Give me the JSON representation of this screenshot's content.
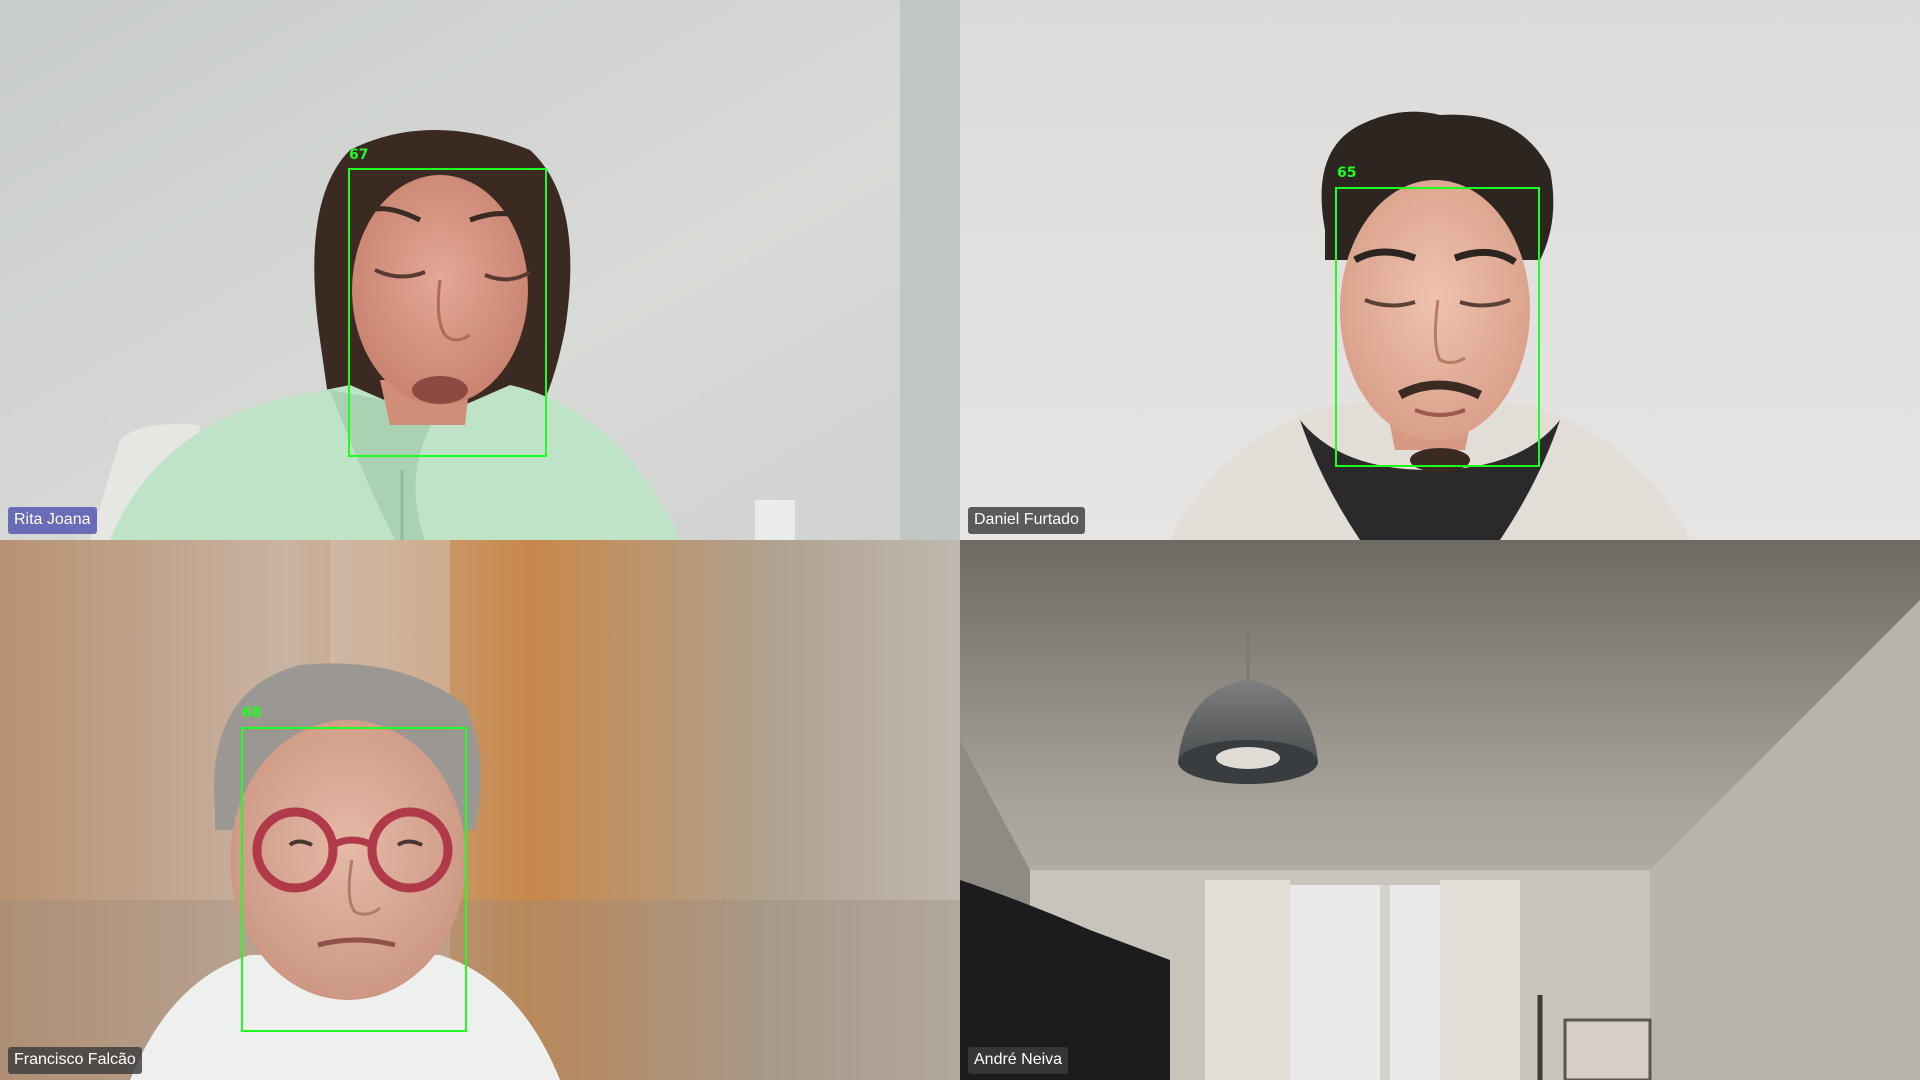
{
  "participants": [
    {
      "name": "Rita Joana",
      "active_speaker": true,
      "face_score": "67"
    },
    {
      "name": "Daniel Furtado",
      "active_speaker": false,
      "face_score": "65"
    },
    {
      "name": "Francisco Falcão",
      "active_speaker": false,
      "face_score": "68"
    },
    {
      "name": "André Neiva",
      "active_speaker": false,
      "face_score": ""
    }
  ],
  "colors": {
    "face_box": "#1fff1f",
    "active_tag": "#5c60b2",
    "name_tag": "#3c3c3c"
  }
}
